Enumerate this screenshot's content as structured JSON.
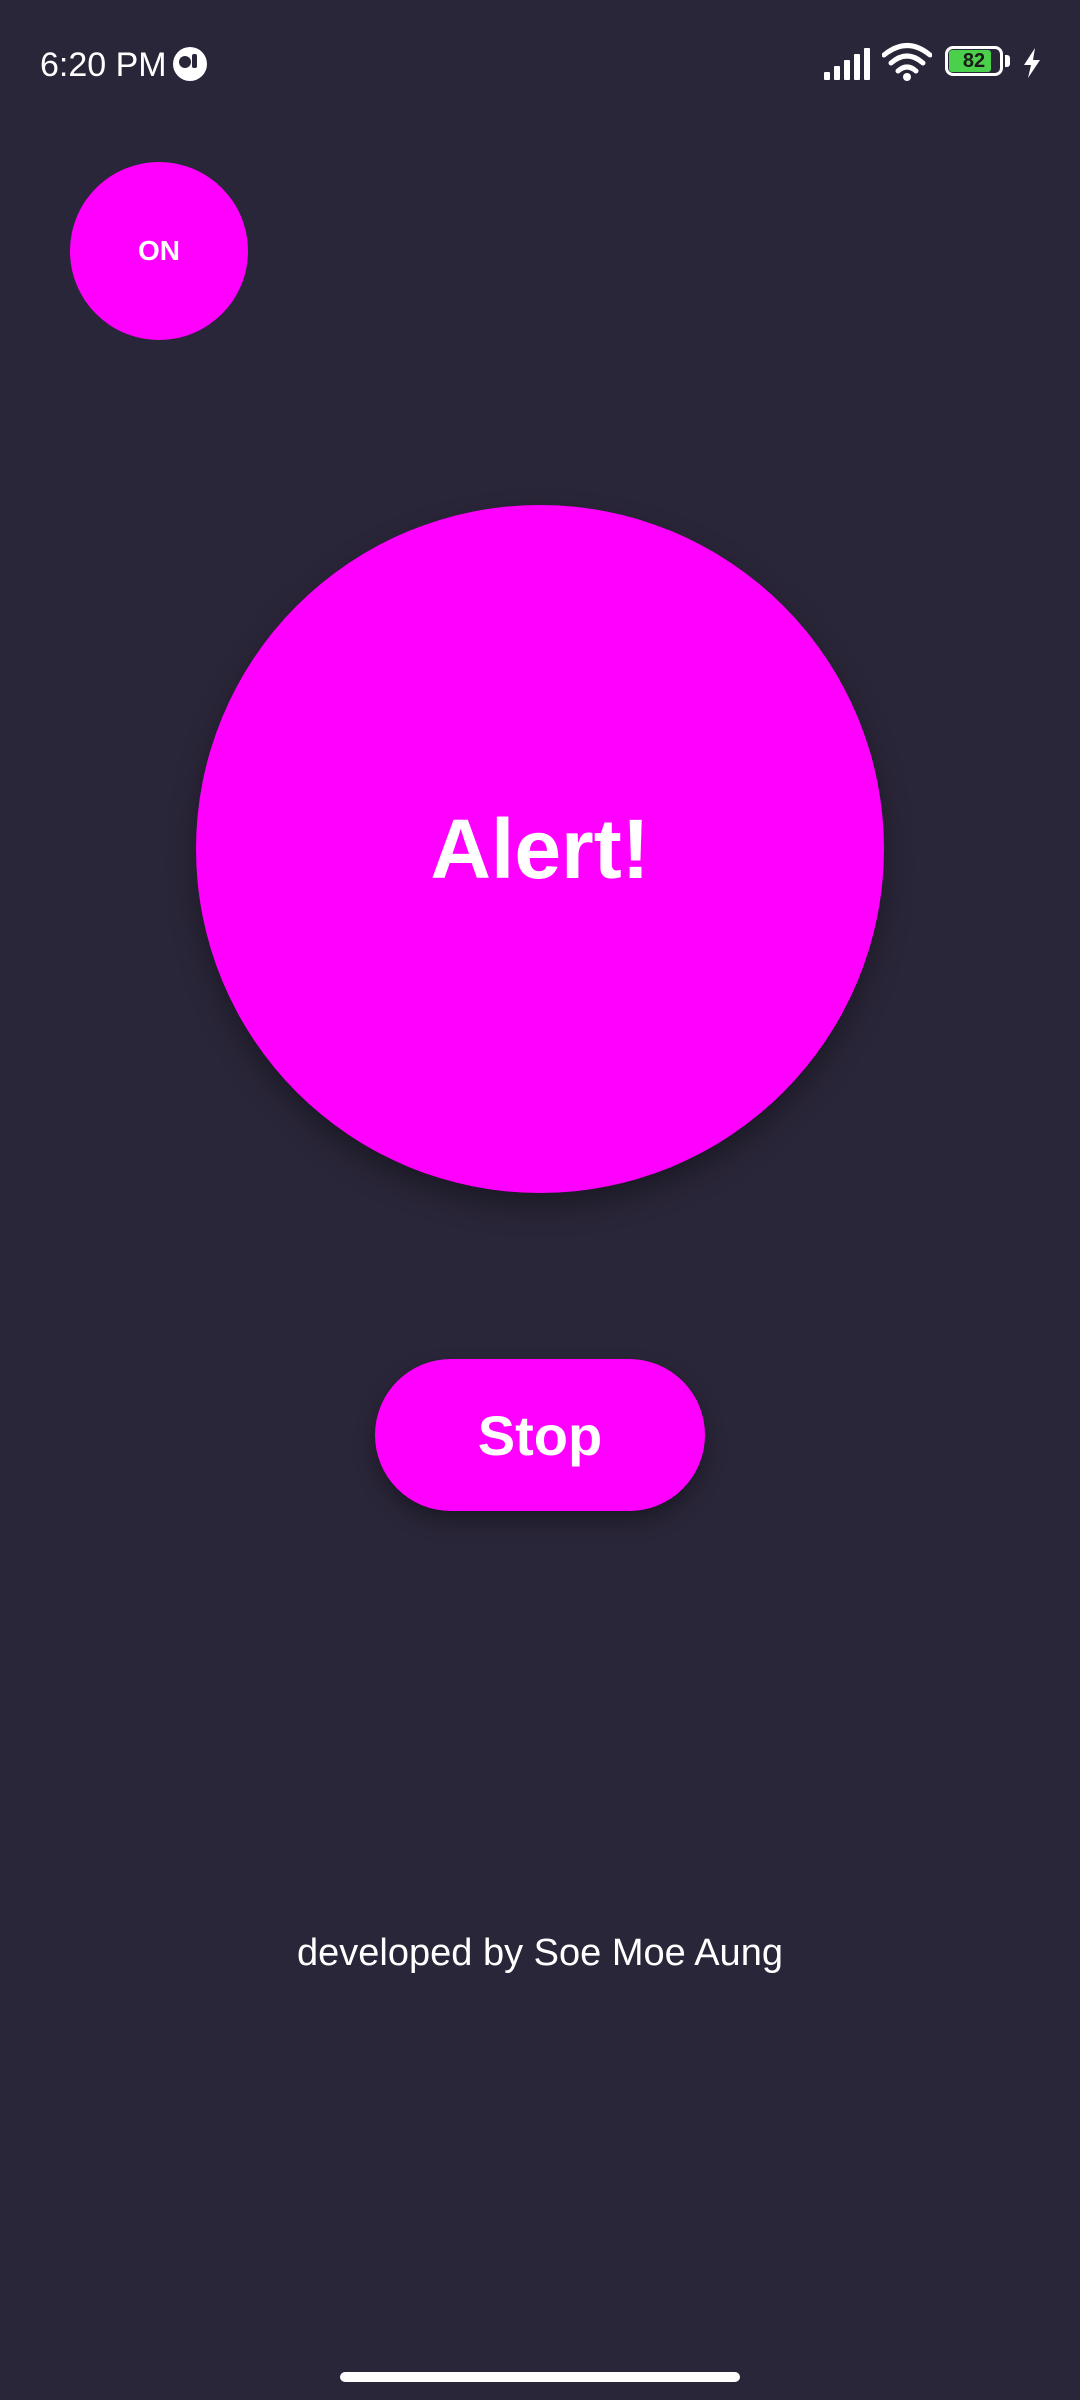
{
  "status_bar": {
    "time": "6:20 PM",
    "battery_level": "82",
    "icons": [
      "app-notification-icon",
      "signal-icon",
      "wifi-icon",
      "battery-icon",
      "charging-icon"
    ]
  },
  "toggle": {
    "label": "ON"
  },
  "alert": {
    "label": "Alert!"
  },
  "stop_button": {
    "label": "Stop"
  },
  "footer": {
    "credit": "developed by Soe Moe Aung"
  },
  "colors": {
    "background": "#2a2639",
    "accent": "#ff00ff",
    "text": "#ffffff",
    "battery_fill": "#4bd04b"
  }
}
